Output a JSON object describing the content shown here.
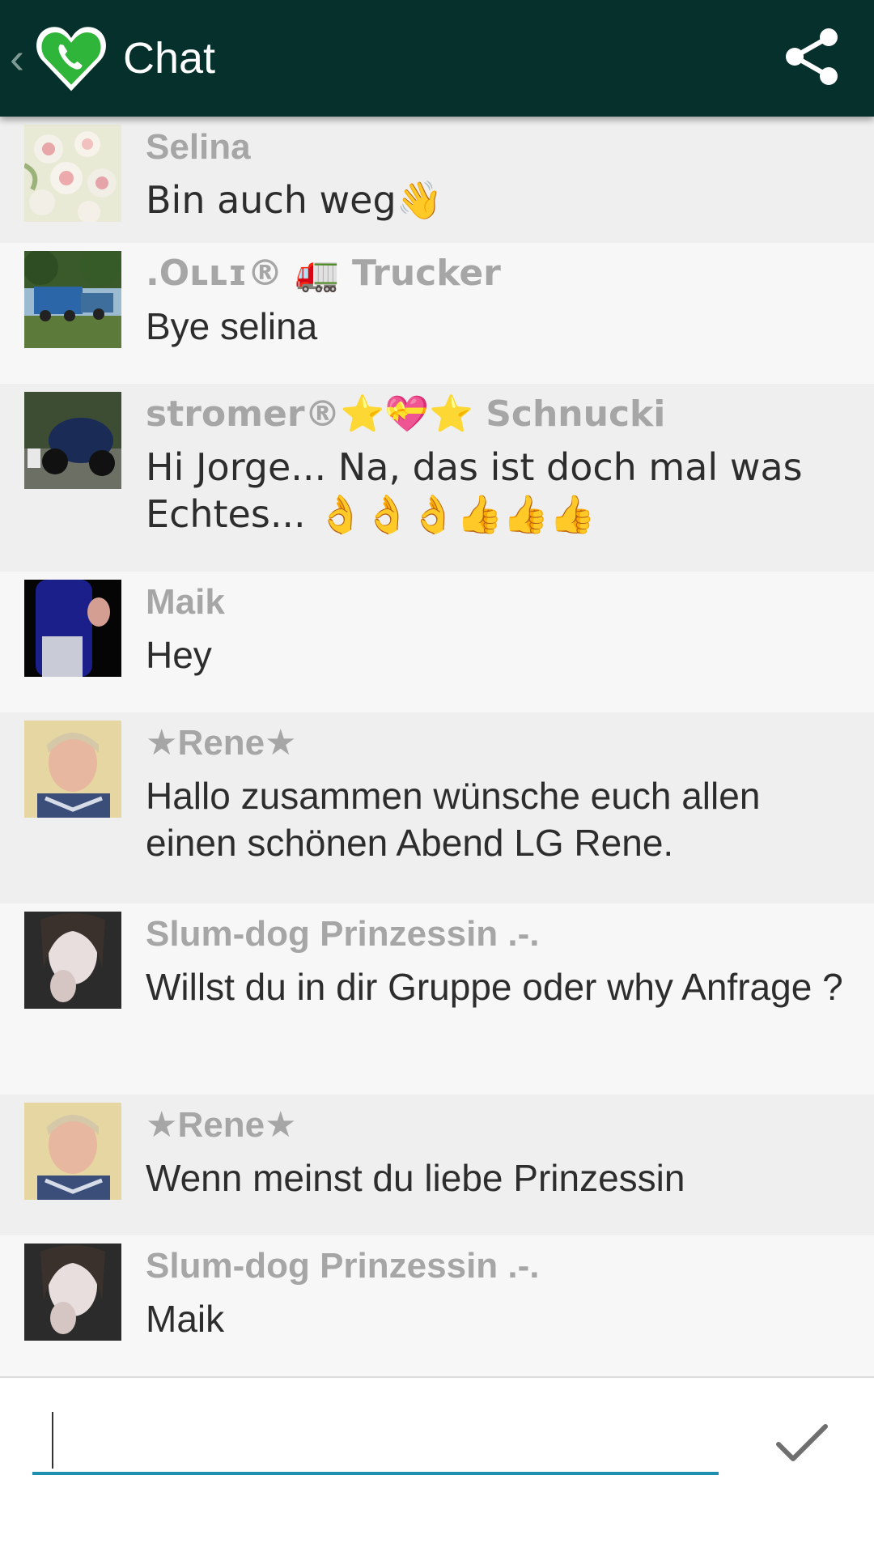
{
  "app": {
    "title": "Chat",
    "back_icon": "chevron-left-icon",
    "logo_icon": "heart-phone-logo",
    "share_icon": "share-icon",
    "header_color": "#05302b"
  },
  "messages": [
    {
      "name": "Selina",
      "text": "Bin auch weg👋",
      "avatar": "roses-photo"
    },
    {
      "name": ".Oʟʟɪ® 🚛 Trucker",
      "text": "Bye selina",
      "avatar": "truck-photo"
    },
    {
      "name": "stromer®⭐💝⭐      Schnucki",
      "text": "Hi Jorge...   Na, das ist doch mal was Echtes...  👌👌👌👍👍👍",
      "avatar": "motorcycle-photo"
    },
    {
      "name": "Maik",
      "text": "Hey",
      "avatar": "bottle-photo"
    },
    {
      "name": "★Rene★",
      "text": "Hallo zusammen wünsche euch allen einen schönen Abend LG Rene.",
      "avatar": "man-portrait"
    },
    {
      "name": "Slum-dog Prinzessin .-.",
      "text": "Willst du in dir Gruppe oder why Anfrage ?",
      "avatar": "woman-portrait"
    },
    {
      "name": "★Rene★",
      "text": "Wenn meinst du liebe Prinzessin",
      "avatar": "man-portrait"
    },
    {
      "name": "Slum-dog Prinzessin .-.",
      "text": "Maik",
      "avatar": "woman-portrait"
    }
  ],
  "composer": {
    "placeholder": "",
    "value": "",
    "send_icon": "checkmark-icon",
    "accent": "#1f8fb0"
  }
}
